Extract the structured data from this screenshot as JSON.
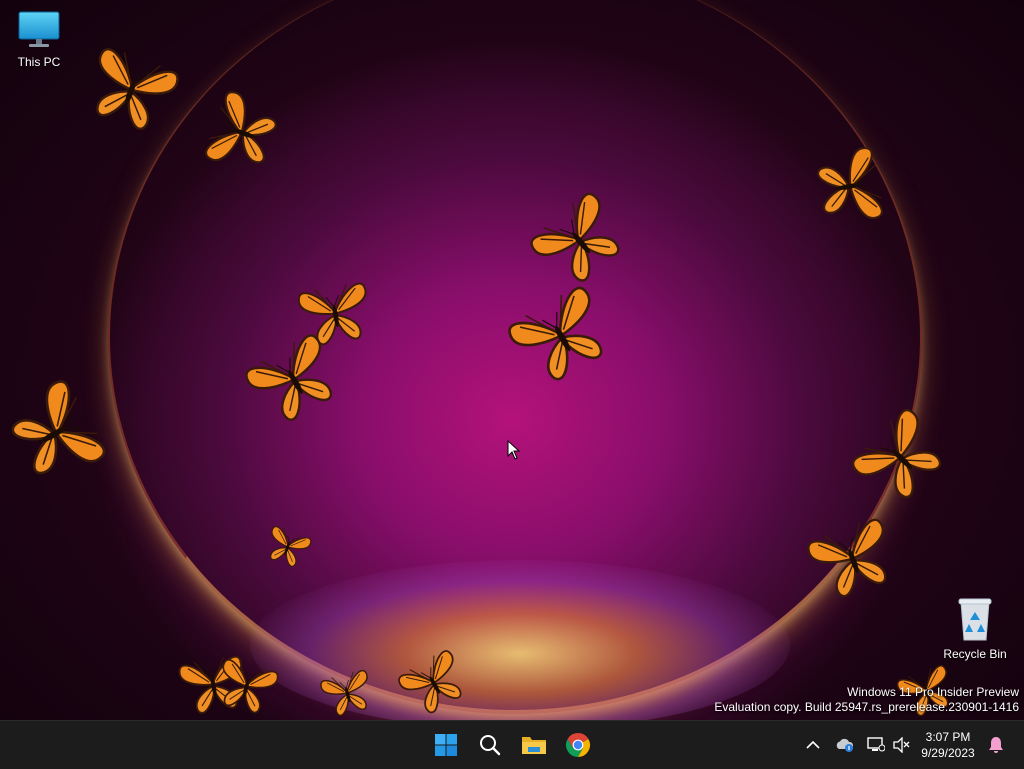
{
  "desktop": {
    "icons": [
      {
        "label": "This PC",
        "icon": "computer-monitor-icon"
      },
      {
        "label": "Recycle Bin",
        "icon": "recycle-bin-icon"
      }
    ],
    "watermark": {
      "line1": "Windows 11 Pro Insider Preview",
      "line2": "Evaluation copy. Build 25947.rs_prerelease.230901-1416"
    },
    "wallpaper": {
      "theme": "butterflies",
      "accent": "#b4127a",
      "butterfly_color": "#f08a1c"
    }
  },
  "taskbar": {
    "pinned": [
      {
        "name": "Start",
        "icon": "windows-start-icon"
      },
      {
        "name": "Search",
        "icon": "search-icon"
      },
      {
        "name": "File Explorer",
        "icon": "folder-icon"
      },
      {
        "name": "Google Chrome",
        "icon": "chrome-icon"
      }
    ],
    "tray": {
      "icons": [
        "chevron-up-icon",
        "onedrive-icon",
        "network-icon",
        "volume-muted-icon",
        "notification-bell-icon"
      ]
    },
    "clock": {
      "time": "3:07 PM",
      "date": "9/29/2023"
    },
    "background": "#1c1c1c"
  }
}
